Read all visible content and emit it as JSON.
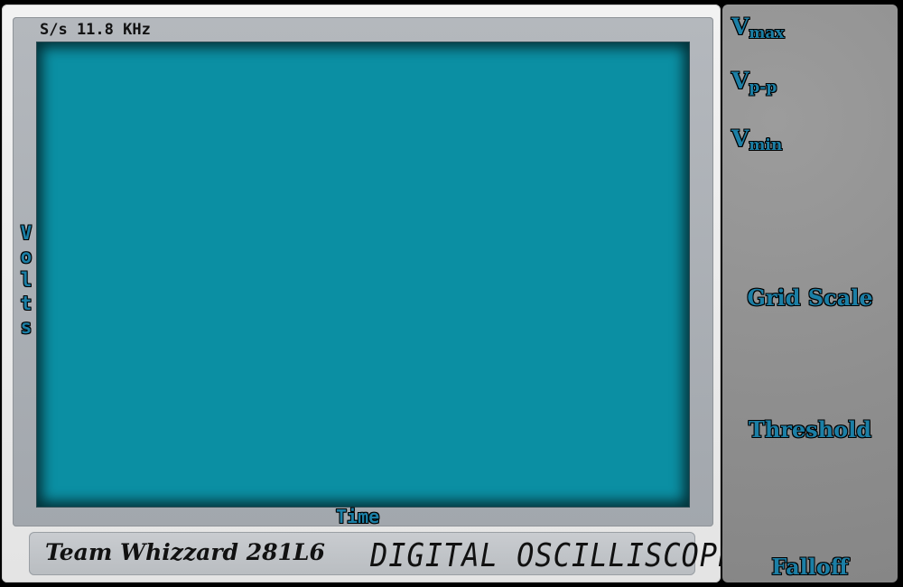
{
  "window": {
    "title": ""
  },
  "screen": {
    "sample_rate": "S/s 11.8 KHz",
    "y_axis_label": [
      "V",
      "o",
      "l",
      "t",
      "s"
    ],
    "x_axis_label": "Time",
    "background_color": "#0b8fa3"
  },
  "nameplate": {
    "team": "Team Whizzard 281L6",
    "product": "DIGITAL OSCILLISCOPE"
  },
  "readouts": {
    "vmax": {
      "base": "V",
      "sub": "max"
    },
    "vpp": {
      "base": "V",
      "sub": "p-p"
    },
    "vmin": {
      "base": "V",
      "sub": "min"
    }
  },
  "controls": {
    "grid_scale": "Grid Scale",
    "threshold": "Threshold",
    "falloff": "Falloff"
  },
  "colors": {
    "label_accent": "#1b7fa6",
    "panel_gray": "#8e8e8e",
    "bezel_gray": "#a2a7ad"
  }
}
